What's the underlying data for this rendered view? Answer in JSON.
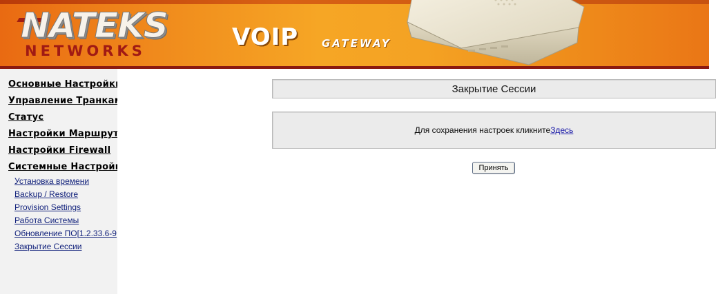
{
  "header": {
    "logo_top": "NATEKS",
    "logo_bottom": "NETWORKS",
    "product_main": "VOIP",
    "product_sub": "GATEWAY",
    "device_image": "voip-gateway-device"
  },
  "sidebar": {
    "main_items": [
      {
        "label": "Основные Настройки"
      },
      {
        "label": "Управление Транками"
      },
      {
        "label": "Статус"
      },
      {
        "label": "Настройки Маршрутизации"
      },
      {
        "label": "Настройки Firewall"
      },
      {
        "label": "Системные Настройки"
      }
    ],
    "sub_items": [
      {
        "label": "Установка времени"
      },
      {
        "label": "Backup / Restore"
      },
      {
        "label": "Provision Settings"
      },
      {
        "label": "Работа Системы"
      },
      {
        "label": "Обновление ПО[1.2.33.6-9"
      },
      {
        "label": "Закрытие Сессии"
      }
    ]
  },
  "main": {
    "title": "Закрытие Сессии",
    "message_prefix": "Для сохранения настроек кликните",
    "message_link": "Здесь",
    "accept_button": "Принять"
  },
  "colors": {
    "banner_orange": "#f08a1c",
    "banner_dark_red": "#8b1a10",
    "sidebar_bg": "#f2f2f2",
    "panel_bg": "#ebebeb",
    "link_blue": "#1a1aa8"
  }
}
